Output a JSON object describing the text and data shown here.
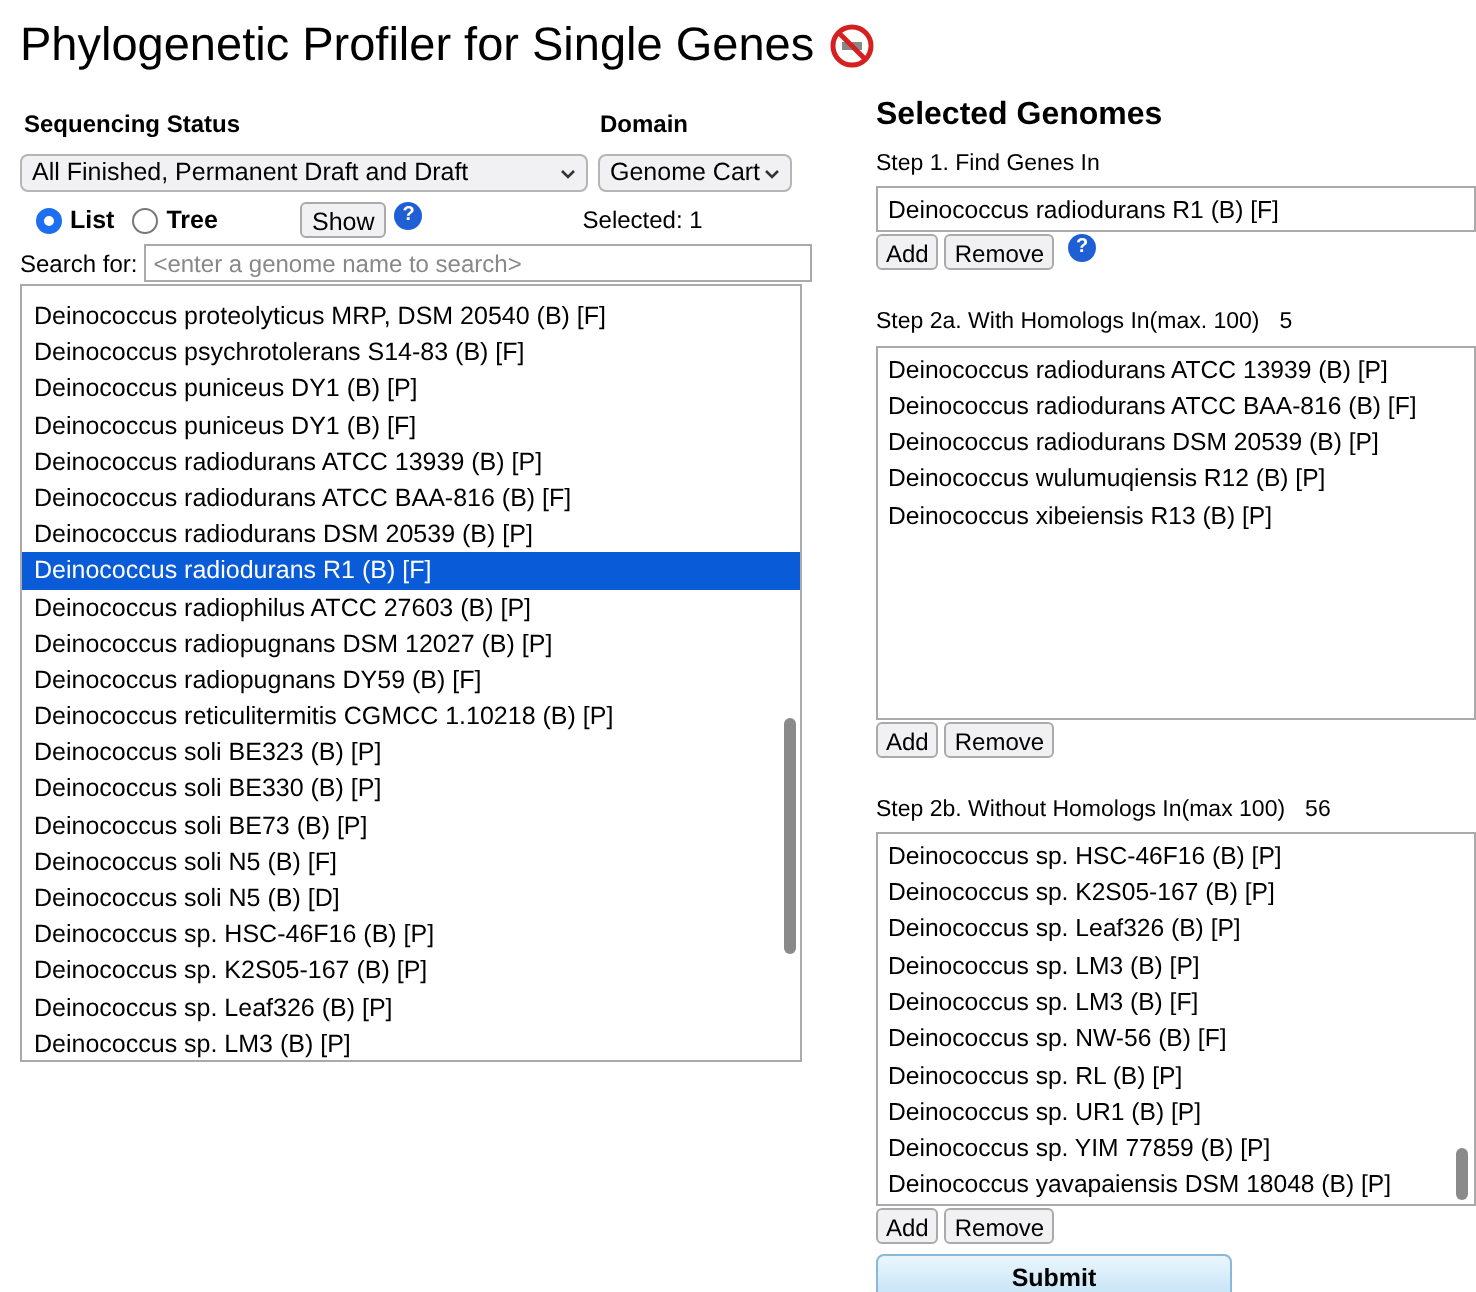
{
  "title": "Phylogenetic Profiler for Single Genes",
  "filters": {
    "status_label": "Sequencing Status",
    "status_value": "All Finished, Permanent Draft and Draft",
    "domain_label": "Domain",
    "domain_value": "Genome Cart",
    "views": [
      {
        "label": "List",
        "selected": true
      },
      {
        "label": "Tree",
        "selected": false
      }
    ],
    "show_button": "Show",
    "help": "?",
    "selected_count": "Selected: 1",
    "search_label": "Search for:",
    "search_placeholder": "<enter a genome name to search>"
  },
  "genome_list": [
    {
      "label": "Deinococcus proteolyticus MRP, DSM 20540 (B) [F]",
      "selected": false
    },
    {
      "label": "Deinococcus psychrotolerans S14-83 (B) [F]",
      "selected": false
    },
    {
      "label": "Deinococcus puniceus DY1 (B) [P]",
      "selected": false
    },
    {
      "label": "Deinococcus puniceus DY1 (B) [F]",
      "selected": false
    },
    {
      "label": "Deinococcus radiodurans ATCC 13939 (B) [P]",
      "selected": false
    },
    {
      "label": "Deinococcus radiodurans ATCC BAA-816 (B) [F]",
      "selected": false
    },
    {
      "label": "Deinococcus radiodurans DSM 20539 (B) [P]",
      "selected": false
    },
    {
      "label": "Deinococcus radiodurans R1 (B) [F]",
      "selected": true
    },
    {
      "label": "Deinococcus radiophilus ATCC 27603 (B) [P]",
      "selected": false
    },
    {
      "label": "Deinococcus radiopugnans DSM 12027 (B) [P]",
      "selected": false
    },
    {
      "label": "Deinococcus radiopugnans DY59 (B) [F]",
      "selected": false
    },
    {
      "label": "Deinococcus reticulitermitis CGMCC 1.10218 (B) [P]",
      "selected": false
    },
    {
      "label": "Deinococcus soli BE323 (B) [P]",
      "selected": false
    },
    {
      "label": "Deinococcus soli BE330 (B) [P]",
      "selected": false
    },
    {
      "label": "Deinococcus soli BE73 (B) [P]",
      "selected": false
    },
    {
      "label": "Deinococcus soli N5 (B) [F]",
      "selected": false
    },
    {
      "label": "Deinococcus soli N5 (B) [D]",
      "selected": false
    },
    {
      "label": "Deinococcus sp. HSC-46F16 (B) [P]",
      "selected": false
    },
    {
      "label": "Deinococcus sp. K2S05-167 (B) [P]",
      "selected": false
    },
    {
      "label": "Deinococcus sp. Leaf326 (B) [P]",
      "selected": false
    },
    {
      "label": "Deinococcus sp. LM3 (B) [P]",
      "selected": false
    }
  ],
  "selected_genomes": {
    "heading": "Selected Genomes",
    "step1": {
      "label": "Step 1. Find Genes In",
      "items": [
        "Deinococcus radiodurans R1 (B) [F]"
      ],
      "add": "Add",
      "remove": "Remove",
      "help": "?"
    },
    "step2a": {
      "label": "Step 2a. With Homologs In(max. 100)",
      "count": "5",
      "items": [
        "Deinococcus radiodurans ATCC 13939 (B) [P]",
        "Deinococcus radiodurans ATCC BAA-816 (B) [F]",
        "Deinococcus radiodurans DSM 20539 (B) [P]",
        "Deinococcus wulumuqiensis R12 (B) [P]",
        "Deinococcus xibeiensis R13 (B) [P]"
      ],
      "add": "Add",
      "remove": "Remove"
    },
    "step2b": {
      "label": "Step 2b. Without Homologs In(max 100)",
      "count": "56",
      "items": [
        "Deinococcus sp. HSC-46F16 (B) [P]",
        "Deinococcus sp. K2S05-167 (B) [P]",
        "Deinococcus sp. Leaf326 (B) [P]",
        "Deinococcus sp. LM3 (B) [P]",
        "Deinococcus sp. LM3 (B) [F]",
        "Deinococcus sp. NW-56 (B) [F]",
        "Deinococcus sp. RL (B) [P]",
        "Deinococcus sp. UR1 (B) [P]",
        "Deinococcus sp. YIM 77859 (B) [P]",
        "Deinococcus yavapaiensis DSM 18048 (B) [P]"
      ],
      "add": "Add",
      "remove": "Remove"
    }
  },
  "submit": "Submit"
}
